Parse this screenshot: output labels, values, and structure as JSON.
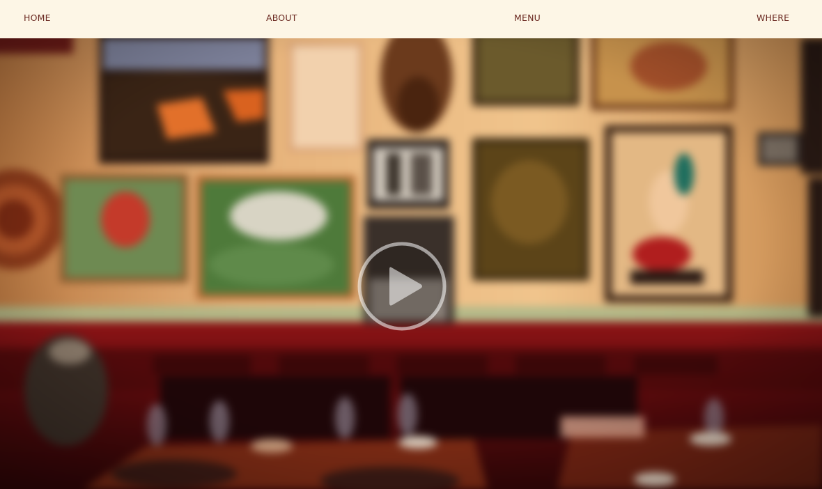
{
  "nav": {
    "items": [
      {
        "label": "HOME"
      },
      {
        "label": "ABOUT"
      },
      {
        "label": "MENU"
      },
      {
        "label": "WHERE"
      }
    ]
  },
  "hero": {
    "play_icon": "play-icon"
  },
  "colors": {
    "nav_background": "#fdf6e6",
    "nav_text": "#6b2a22",
    "wall": "#e8b47a",
    "wainscot": "#7a0f12"
  }
}
